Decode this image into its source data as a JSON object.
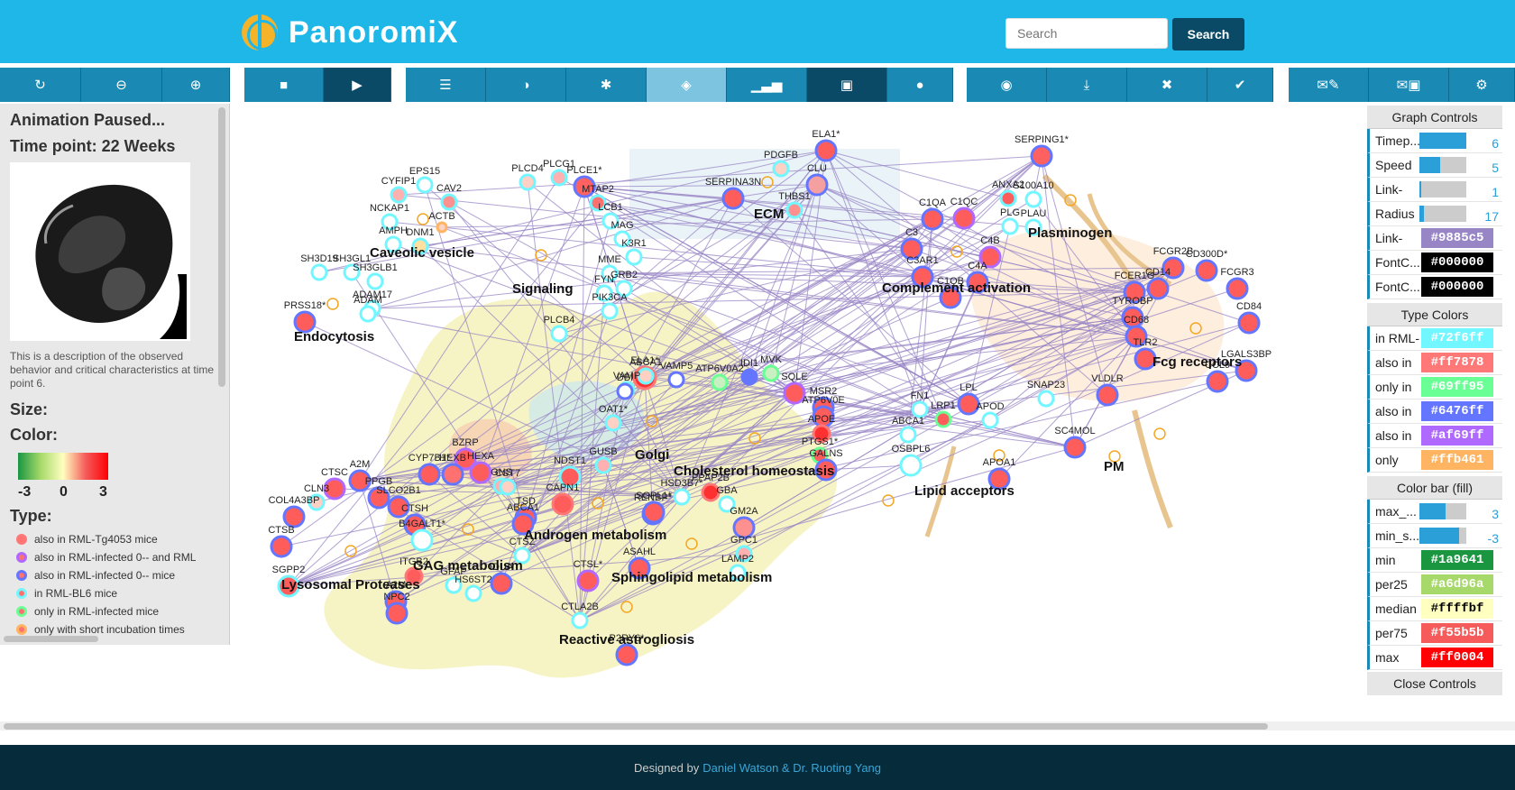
{
  "header": {
    "logo_text": "PanoromiX",
    "search_placeholder": "Search",
    "search_button": "Search"
  },
  "toolbar": {
    "icons": [
      "refresh-icon",
      "zoom-out-icon",
      "zoom-in-icon",
      "stop-icon",
      "play-icon",
      "list-icon",
      "contrast-icon",
      "asterisk-icon",
      "eye-slash-icon",
      "bar-chart-icon",
      "image-icon",
      "droplet-icon",
      "camera-icon",
      "download-icon",
      "file-remove-icon",
      "file-save-icon",
      "mail-edit-icon",
      "mail-lock-icon",
      "gear-icon"
    ]
  },
  "left_panel": {
    "status": "Animation Paused...",
    "time_point": "Time point: 22 Weeks",
    "description": "This is a description of the observed behavior and critical characteristics at time point 6.",
    "size_label": "Size:",
    "color_label": "Color:",
    "color_min": "-3",
    "color_mid": "0",
    "color_max": "3",
    "type_label": "Type:",
    "types": [
      {
        "label": "also in RML-Tg4053 mice",
        "color": "#ff7878"
      },
      {
        "label": "also in RML-infected 0-- and RML",
        "color": "#af69ff"
      },
      {
        "label": "also in RML-infected 0-- mice",
        "color": "#6476ff"
      },
      {
        "label": "in RML-BL6 mice",
        "color": "#72f6ff"
      },
      {
        "label": "only in RML-infected mice",
        "color": "#69ff95"
      },
      {
        "label": "only with short incubation times",
        "color": "#ffb461"
      }
    ]
  },
  "graph": {
    "groups": [
      {
        "label": "Caveolic vesicle"
      },
      {
        "label": "Signaling"
      },
      {
        "label": "Endocytosis"
      },
      {
        "label": "ECM"
      },
      {
        "label": "Plasminogen"
      },
      {
        "label": "Complement activation"
      },
      {
        "label": "Fcg receptors"
      },
      {
        "label": "Golgi"
      },
      {
        "label": "Cholesterol homeostasis"
      },
      {
        "label": "Lipid acceptors"
      },
      {
        "label": "PM"
      },
      {
        "label": "Androgen metabolism"
      },
      {
        "label": "GAG metabolism"
      },
      {
        "label": "Lysosomal Proteases"
      },
      {
        "label": "Sphingolipid metabolism"
      },
      {
        "label": "Reactive astrogliosis"
      }
    ],
    "nodes": [
      {
        "label": "ELA1*"
      },
      {
        "label": "PDGFB"
      },
      {
        "label": "CLU"
      },
      {
        "label": "SERPING1*"
      },
      {
        "label": "EPS15"
      },
      {
        "label": "CYFIP1"
      },
      {
        "label": "CAV2"
      },
      {
        "label": "PLCD4"
      },
      {
        "label": "PLCG1"
      },
      {
        "label": "PLCE1*"
      },
      {
        "label": "MTAP2"
      },
      {
        "label": "SERPINA3N"
      },
      {
        "label": "THBS1"
      },
      {
        "label": "ANXA2"
      },
      {
        "label": "S100A10"
      },
      {
        "label": "NCKAP1"
      },
      {
        "label": "ACTB"
      },
      {
        "label": "AMPH"
      },
      {
        "label": "DNM1"
      },
      {
        "label": "C1QA"
      },
      {
        "label": "C1QC"
      },
      {
        "label": "PLG"
      },
      {
        "label": "PLAU"
      },
      {
        "label": "LCB1"
      },
      {
        "label": "MAG"
      },
      {
        "label": "K3R1"
      },
      {
        "label": "C3"
      },
      {
        "label": "C4B"
      },
      {
        "label": "SH3D19"
      },
      {
        "label": "SH3GL1"
      },
      {
        "label": "SH3GLB1"
      },
      {
        "label": "MME"
      },
      {
        "label": "GRB2"
      },
      {
        "label": "C3AR1"
      },
      {
        "label": "C4A"
      },
      {
        "label": "FCGR2B"
      },
      {
        "label": "CD300D*"
      },
      {
        "label": "FCGR3"
      },
      {
        "label": "ADAM17"
      },
      {
        "label": "FYN"
      },
      {
        "label": "C1QB"
      },
      {
        "label": "FCER1G"
      },
      {
        "label": "CD14"
      },
      {
        "label": "PRSS18*"
      },
      {
        "label": "ADAM"
      },
      {
        "label": "PIK3CA"
      },
      {
        "label": "TYROBP"
      },
      {
        "label": "CD84"
      },
      {
        "label": "PLCB4"
      },
      {
        "label": "CD68"
      },
      {
        "label": "TLR2"
      },
      {
        "label": "LGALS3BP"
      },
      {
        "label": "ELA1*"
      },
      {
        "label": "ABCA1"
      },
      {
        "label": "VAMP5"
      },
      {
        "label": "VAMP"
      },
      {
        "label": "ATP6V0A2"
      },
      {
        "label": "IDI1"
      },
      {
        "label": "MVK"
      },
      {
        "label": "SQLE"
      },
      {
        "label": "DBI"
      },
      {
        "label": "SNAP23"
      },
      {
        "label": "FN1"
      },
      {
        "label": "LRP1"
      },
      {
        "label": "LPL"
      },
      {
        "label": "APOD"
      },
      {
        "label": "VLDLR"
      },
      {
        "label": "CCL9"
      },
      {
        "label": "MSR2"
      },
      {
        "label": "OAT1*"
      },
      {
        "label": "ATP6V0E"
      },
      {
        "label": "ABCA1"
      },
      {
        "label": "APOE"
      },
      {
        "label": "SC4MOL"
      },
      {
        "label": "PTGS1*"
      },
      {
        "label": "BZRP"
      },
      {
        "label": "GUSB"
      },
      {
        "label": "CYP7B1*"
      },
      {
        "label": "HEXB"
      },
      {
        "label": "HEXA"
      },
      {
        "label": "GNS"
      },
      {
        "label": "GALNS"
      },
      {
        "label": "OSBPL6"
      },
      {
        "label": "APOA1"
      },
      {
        "label": "A2M"
      },
      {
        "label": "CTSC"
      },
      {
        "label": "CLN3"
      },
      {
        "label": "PPGB"
      },
      {
        "label": "CST7"
      },
      {
        "label": "NDST1"
      },
      {
        "label": "SLCO2B1"
      },
      {
        "label": "CAPN1"
      },
      {
        "label": "HSD3B7*"
      },
      {
        "label": "PPAP2B"
      },
      {
        "label": "GBA"
      },
      {
        "label": "COL4A3BP"
      },
      {
        "label": "CTSH"
      },
      {
        "label": "TSD"
      },
      {
        "label": "RENBP*"
      },
      {
        "label": "SGPL1*"
      },
      {
        "label": "ABCA1"
      },
      {
        "label": "GM2A"
      },
      {
        "label": "B4GALT1*"
      },
      {
        "label": "CTSB"
      },
      {
        "label": "CTSZ"
      },
      {
        "label": "GPC1"
      },
      {
        "label": "ASAHL"
      },
      {
        "label": "ITGB2"
      },
      {
        "label": "LAMP2"
      },
      {
        "label": "SGPP2"
      },
      {
        "label": "CTSL*"
      },
      {
        "label": "GFAP"
      },
      {
        "label": "HS6ST2"
      },
      {
        "label": "IDUA"
      },
      {
        "label": "A2M"
      },
      {
        "label": "NPC2"
      },
      {
        "label": "CTLA2B"
      },
      {
        "label": "P2RY6*"
      },
      {
        "label": "VIM"
      }
    ]
  },
  "controls": {
    "graph_controls_title": "Graph Controls",
    "sliders": [
      {
        "label": "Timep...",
        "value": "6",
        "fraction": 1.0
      },
      {
        "label": "Speed",
        "value": "5",
        "fraction": 0.45
      },
      {
        "label": "Link-",
        "value": "1",
        "fraction": 0.0
      },
      {
        "label": "Radius",
        "value": "17",
        "fraction": 0.1
      }
    ],
    "graph_swatches": [
      {
        "label": "Link-",
        "value": "#9885c5",
        "color": "#9885c5"
      },
      {
        "label": "FontC...",
        "value": "#000000",
        "color": "#000000"
      },
      {
        "label": "FontC...",
        "value": "#000000",
        "color": "#000000"
      }
    ],
    "type_colors_title": "Type Colors",
    "type_swatches": [
      {
        "label": "in RML-",
        "value": "#72f6ff",
        "color": "#72f6ff"
      },
      {
        "label": "also in",
        "value": "#ff7878",
        "color": "#ff7878"
      },
      {
        "label": "only in",
        "value": "#69ff95",
        "color": "#69ff95"
      },
      {
        "label": "also in",
        "value": "#6476ff",
        "color": "#6476ff"
      },
      {
        "label": "also in",
        "value": "#af69ff",
        "color": "#af69ff"
      },
      {
        "label": "only",
        "value": "#ffb461",
        "color": "#ffb461"
      }
    ],
    "color_bar_title": "Color bar (fill)",
    "color_bar_sliders": [
      {
        "label": "max_...",
        "value": "3",
        "fraction": 0.55
      },
      {
        "label": "min_s...",
        "value": "-3",
        "fraction": 0.85
      }
    ],
    "color_bar_swatches": [
      {
        "label": "min",
        "value": "#1a9641",
        "color": "#1a9641",
        "text_color": "#ffffff"
      },
      {
        "label": "per25",
        "value": "#a6d96a",
        "color": "#a6d96a",
        "text_color": "#ffffff"
      },
      {
        "label": "median",
        "value": "#ffffbf",
        "color": "#ffffbf",
        "text_color": "#000000"
      },
      {
        "label": "per75",
        "value": "#f55b5b",
        "color": "#f55b5b",
        "text_color": "#ffffff"
      },
      {
        "label": "max",
        "value": "#ff0004",
        "color": "#ff0004",
        "text_color": "#ffffff"
      }
    ],
    "close_label": "Close Controls"
  },
  "footer": {
    "prefix": "Designed by",
    "authors": "Daniel Watson & Dr. Ruoting Yang"
  }
}
